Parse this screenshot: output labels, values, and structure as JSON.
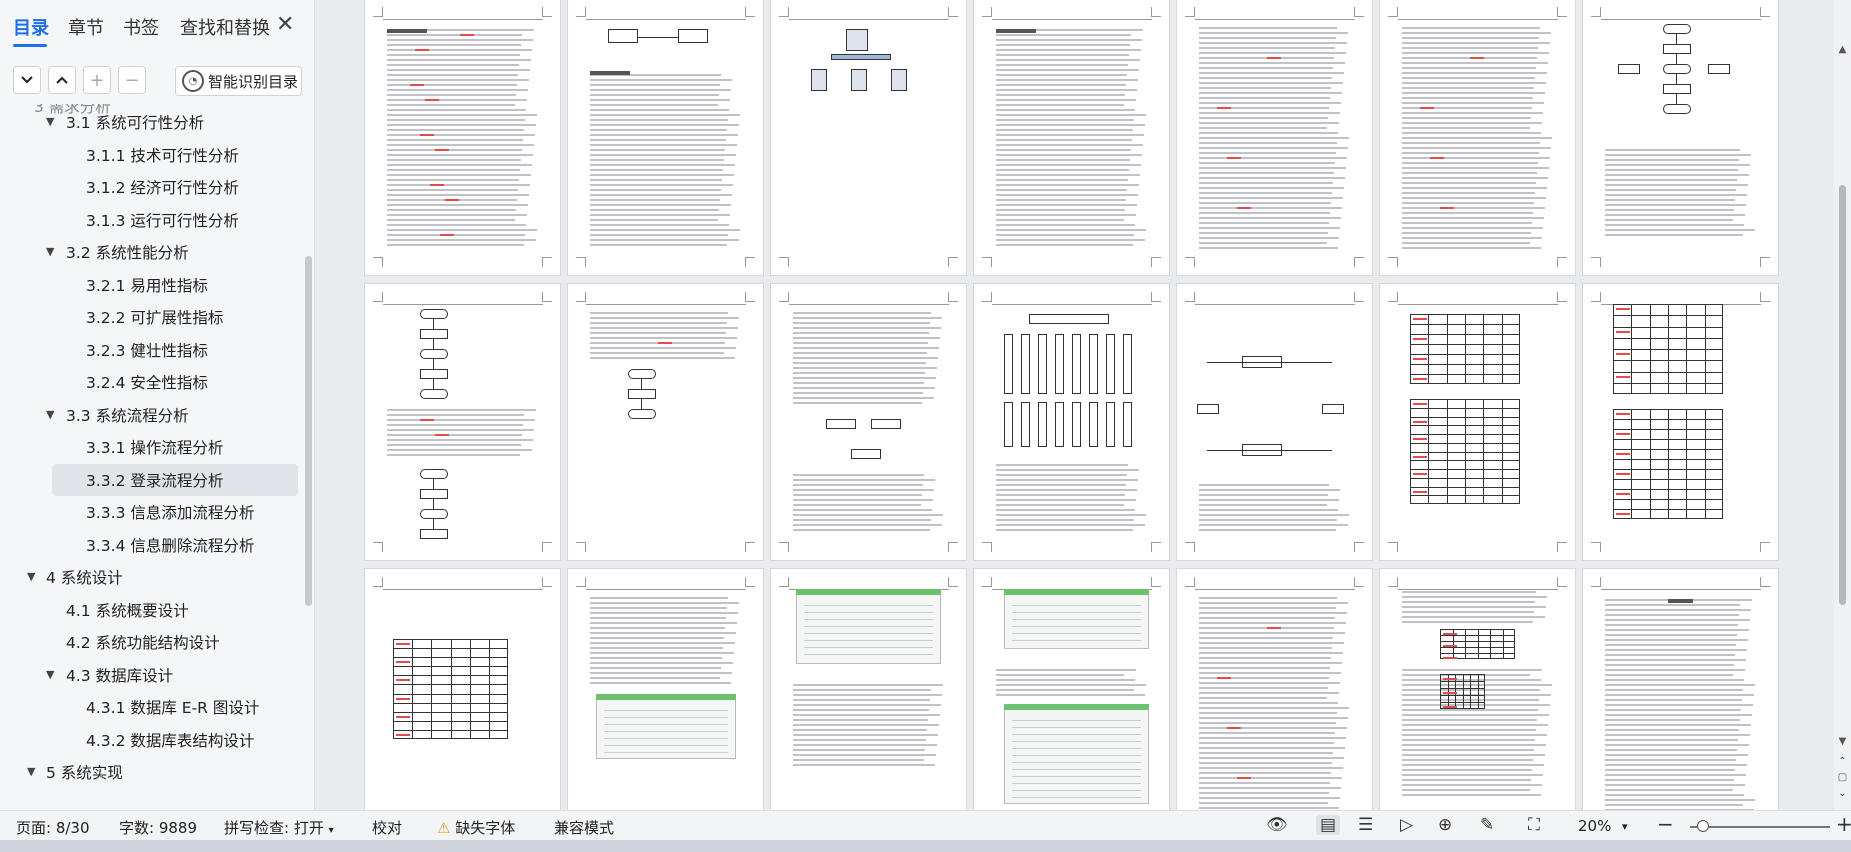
{
  "sidebar": {
    "tabs": [
      "目录",
      "章节",
      "书签",
      "查找和替换"
    ],
    "close_icon": "close-icon",
    "ai_button": "智能识别目录",
    "toc": [
      {
        "label": "3.1 系统可行性分析",
        "level": 2,
        "expanded": true
      },
      {
        "label": "3.1.1 技术可行性分析",
        "level": 3
      },
      {
        "label": "3.1.2 经济可行性分析",
        "level": 3
      },
      {
        "label": "3.1.3 运行可行性分析",
        "level": 3
      },
      {
        "label": "3.2 系统性能分析",
        "level": 2,
        "expanded": true
      },
      {
        "label": "3.2.1 易用性指标",
        "level": 3
      },
      {
        "label": "3.2.2 可扩展性指标",
        "level": 3
      },
      {
        "label": "3.2.3 健壮性指标",
        "level": 3
      },
      {
        "label": "3.2.4 安全性指标",
        "level": 3
      },
      {
        "label": "3.3 系统流程分析",
        "level": 2,
        "expanded": true
      },
      {
        "label": "3.3.1 操作流程分析",
        "level": 3
      },
      {
        "label": "3.3.2 登录流程分析",
        "level": 3,
        "selected": true
      },
      {
        "label": "3.3.3 信息添加流程分析",
        "level": 3
      },
      {
        "label": "3.3.4 信息删除流程分析",
        "level": 3
      },
      {
        "label": "4 系统设计",
        "level": 1,
        "expanded": true
      },
      {
        "label": "4.1 系统概要设计",
        "level": 2
      },
      {
        "label": "4.2 系统功能结构设计",
        "level": 2
      },
      {
        "label": "4.3 数据库设计",
        "level": 2,
        "expanded": true
      },
      {
        "label": "4.3.1 数据库 E-R 图设计",
        "level": 3
      },
      {
        "label": "4.3.2 数据库表结构设计",
        "level": 3
      },
      {
        "label": "5 系统实现",
        "level": 1,
        "expanded": true
      }
    ]
  },
  "status": {
    "page": "页面: 8/30",
    "words": "字数: 9889",
    "spell": "拼写检查: 打开",
    "proof": "校对",
    "missing_font": "缺失字体",
    "compat": "兼容模式",
    "zoom": "20%"
  },
  "colors": {
    "accent": "#1f6fe5",
    "warning": "#e8a317"
  }
}
